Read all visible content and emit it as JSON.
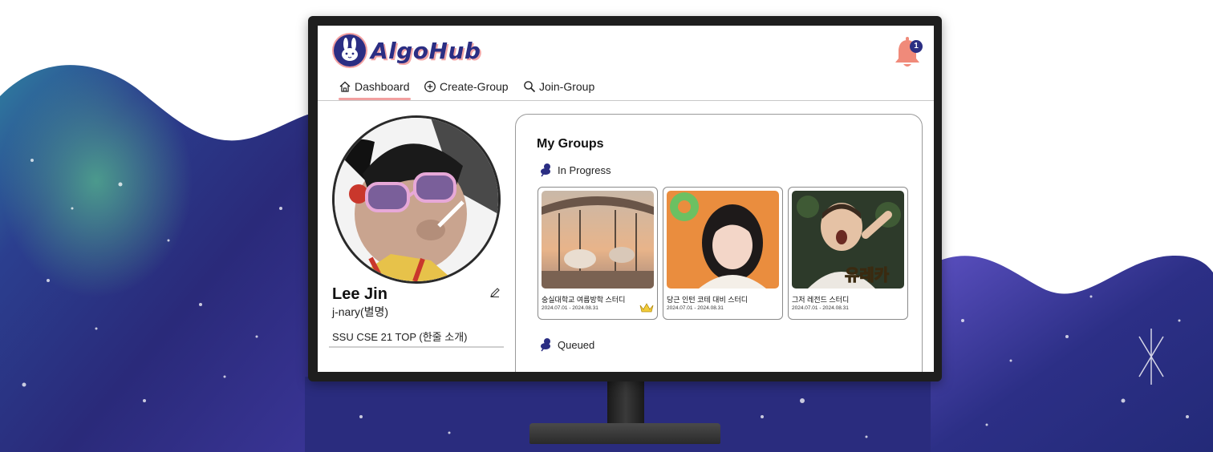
{
  "app": {
    "logo_text": "AlgoHub",
    "notification_count": "1"
  },
  "nav": {
    "items": [
      {
        "label": "Dashboard",
        "icon": "home-icon",
        "active": true
      },
      {
        "label": "Create-Group",
        "icon": "plus-circle-icon"
      },
      {
        "label": "Join-Group",
        "icon": "search-icon"
      }
    ]
  },
  "profile": {
    "name": "Lee Jin",
    "nickname": "j-nary(별명)",
    "bio": "SSU CSE 21 TOP (한줄 소개)"
  },
  "groups": {
    "title": "My Groups",
    "in_progress_label": "In Progress",
    "queued_label": "Queued",
    "cards": [
      {
        "title": "숭실대학교 여름방학 스터디",
        "dates": "2024.07.01 - 2024.08.31",
        "owner": true
      },
      {
        "title": "당근 인턴 코테 대비 스터디",
        "dates": "2024.07.01 - 2024.08.31",
        "owner": false
      },
      {
        "title": "그저 레전드 스터디",
        "dates": "2024.07.01 - 2024.08.31",
        "owner": false,
        "image_caption": "유레카"
      }
    ]
  },
  "colors": {
    "brand_navy": "#2b2e83",
    "accent_pink": "#f2a0a0",
    "bell_coral": "#f08a7a"
  }
}
